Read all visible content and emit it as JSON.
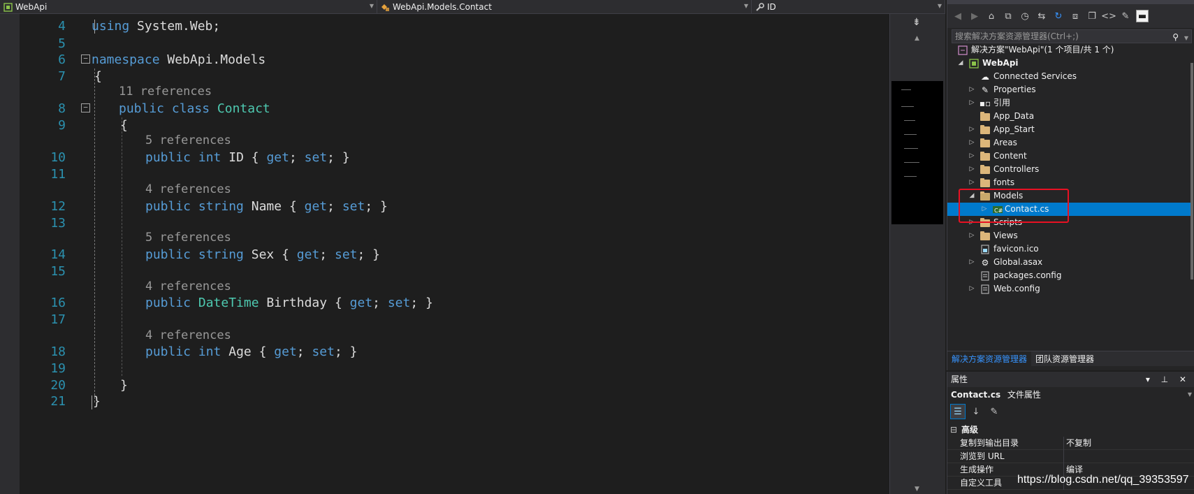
{
  "navbar": {
    "project": "WebApi",
    "type": "WebApi.Models.Contact",
    "member": "ID"
  },
  "code": {
    "line_numbers": [
      "4",
      "5",
      "6",
      "7",
      "8",
      "9",
      "10",
      "11",
      "12",
      "13",
      "14",
      "15",
      "16",
      "17",
      "18",
      "19",
      "20",
      "21"
    ],
    "line4_kw": "using",
    "line4_rest": " System.Web;",
    "line6_kw": "namespace",
    "line6_rest": " WebApi.Models",
    "brace_open": "{",
    "brace_close": "}",
    "class_lens": "11 references",
    "class_kw": "public class",
    "class_name": "Contact",
    "members": [
      {
        "lens": "5 references",
        "mod": "public",
        "type": "int",
        "type_is_kw": true,
        "name": " ID ",
        "get": "get",
        "set": "set"
      },
      {
        "lens": "4 references",
        "mod": "public",
        "type": "string",
        "type_is_kw": true,
        "name": " Name ",
        "get": "get",
        "set": "set"
      },
      {
        "lens": "5 references",
        "mod": "public",
        "type": "string",
        "type_is_kw": true,
        "name": " Sex ",
        "get": "get",
        "set": "set"
      },
      {
        "lens": "4 references",
        "mod": "public",
        "type": "DateTime",
        "type_is_kw": false,
        "name": " Birthday ",
        "get": "get",
        "set": "set"
      },
      {
        "lens": "4 references",
        "mod": "public",
        "type": "int",
        "type_is_kw": true,
        "name": " Age ",
        "get": "get",
        "set": "set"
      }
    ]
  },
  "solution_explorer": {
    "search_placeholder": "搜索解决方案资源管理器(Ctrl+;)",
    "solution_label": "解决方案\"WebApi\"(1 个项目/共 1 个)",
    "project": "WebApi",
    "items": [
      {
        "label": "Connected Services"
      },
      {
        "label": "Properties"
      },
      {
        "label": "引用"
      },
      {
        "label": "App_Data"
      },
      {
        "label": "App_Start"
      },
      {
        "label": "Areas"
      },
      {
        "label": "Content"
      },
      {
        "label": "Controllers"
      },
      {
        "label": "fonts"
      },
      {
        "label": "Models"
      },
      {
        "label": "Contact.cs"
      },
      {
        "label": "Scripts"
      },
      {
        "label": "Views"
      },
      {
        "label": "favicon.ico"
      },
      {
        "label": "Global.asax"
      },
      {
        "label": "packages.config"
      },
      {
        "label": "Web.config"
      }
    ],
    "tabs": [
      "解决方案资源管理器",
      "团队资源管理器"
    ]
  },
  "properties": {
    "title": "属性",
    "object_name": "Contact.cs",
    "object_kind": "文件属性",
    "category": "高级",
    "rows": [
      {
        "name": "复制到输出目录",
        "value": "不复制"
      },
      {
        "name": "浏览到 URL",
        "value": ""
      },
      {
        "name": "生成操作",
        "value": "编译"
      },
      {
        "name": "自定义工具",
        "value": ""
      }
    ]
  },
  "watermark": "https://blog.csdn.net/qq_39353597",
  "colors": {
    "editor_bg": "#1e1e1e",
    "keyword": "#569cd6",
    "type": "#4ec9b0",
    "line_number": "#2b91af",
    "selection": "#007acc",
    "highlight_box": "#e81123"
  }
}
